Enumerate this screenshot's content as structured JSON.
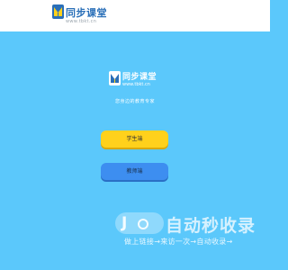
{
  "header": {
    "brand_name": "同步课堂",
    "brand_url": "www.tbkt.cn"
  },
  "center": {
    "brand_name": "同步课堂",
    "brand_url": "www.tbkt.cn",
    "tagline": "您身边的教育专家"
  },
  "buttons": {
    "student_label": "学生端",
    "teacher_label": "教师端"
  },
  "watermark": {
    "title": "自动秒收录",
    "subtitle": "做上链接→来访一次→自动收录→"
  },
  "colors": {
    "background": "#5bc8fb",
    "student_button": "#ffd11c",
    "teacher_button": "#3d8ef0",
    "brand": "#2a6fb8"
  }
}
